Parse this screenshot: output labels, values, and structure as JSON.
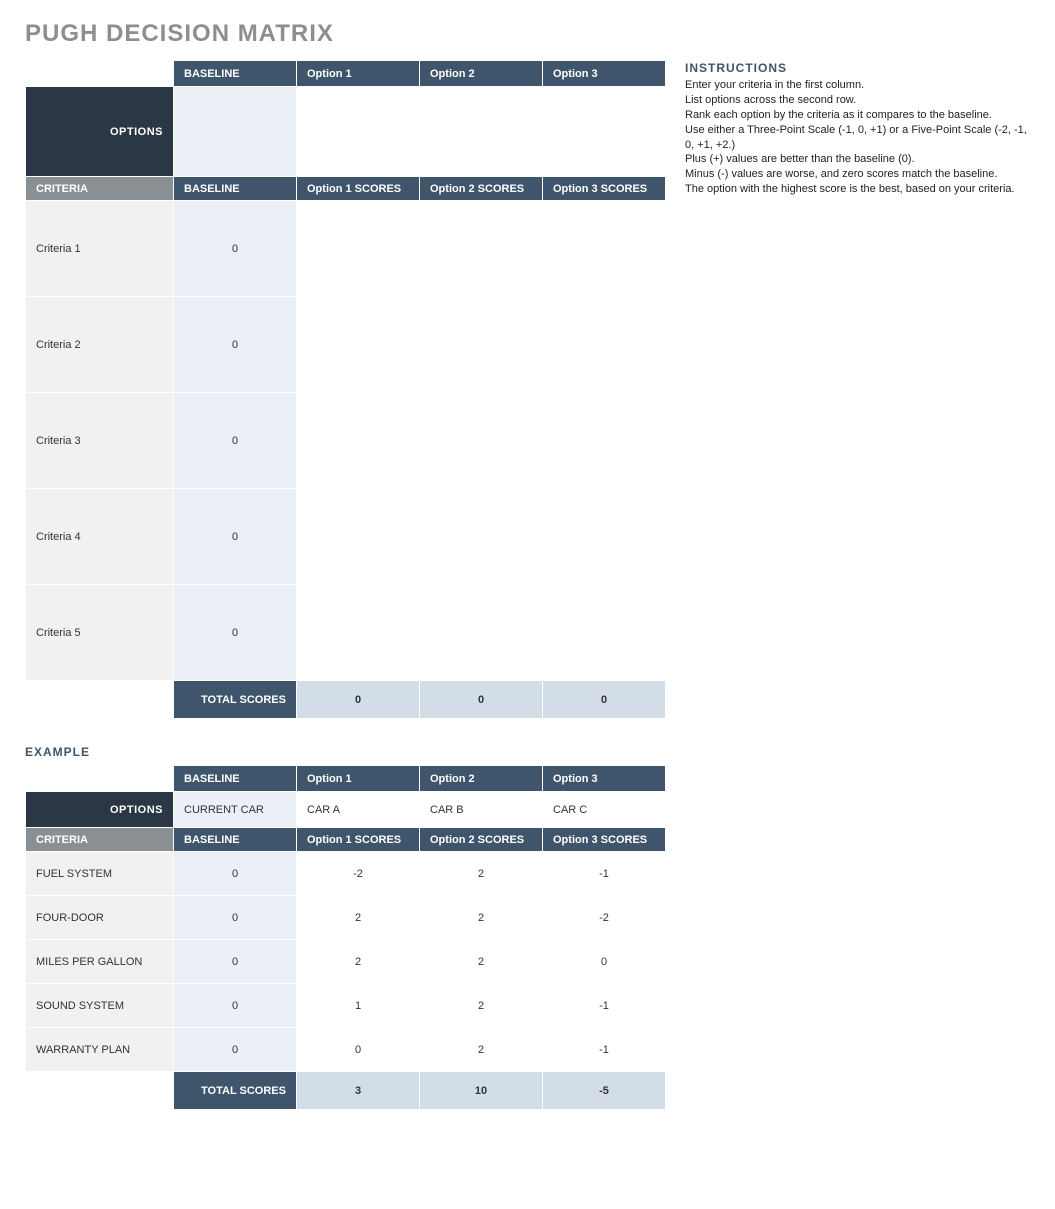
{
  "title": "PUGH DECISION MATRIX",
  "instructions": {
    "header": "INSTRUCTIONS",
    "lines": [
      "Enter your criteria in the first column.",
      "List options across the second row.",
      "Rank each option by the criteria as it compares to the baseline.",
      "Use either a Three-Point Scale (-1, 0, +1) or a Five-Point Scale (-2, -1, 0, +1, +2.)",
      "Plus (+) values are better than the baseline (0).",
      "Minus (-) values are worse, and zero scores match the baseline.",
      "The option with the highest score is the best, based on your criteria."
    ]
  },
  "labels": {
    "options": "OPTIONS",
    "criteria": "CRITERIA",
    "baseline": "BASELINE",
    "total_scores": "TOTAL SCORES",
    "example": "EXAMPLE"
  },
  "main": {
    "option_headers": [
      "BASELINE",
      "Option 1",
      "Option 2",
      "Option 3"
    ],
    "option_values": [
      "",
      "",
      "",
      ""
    ],
    "score_headers": [
      "BASELINE",
      "Option 1 SCORES",
      "Option 2 SCORES",
      "Option 3 SCORES"
    ],
    "rows": [
      {
        "criteria": "Criteria 1",
        "baseline": "0",
        "scores": [
          "",
          "",
          ""
        ]
      },
      {
        "criteria": "Criteria 2",
        "baseline": "0",
        "scores": [
          "",
          "",
          ""
        ]
      },
      {
        "criteria": "Criteria 3",
        "baseline": "0",
        "scores": [
          "",
          "",
          ""
        ]
      },
      {
        "criteria": "Criteria 4",
        "baseline": "0",
        "scores": [
          "",
          "",
          ""
        ]
      },
      {
        "criteria": "Criteria 5",
        "baseline": "0",
        "scores": [
          "",
          "",
          ""
        ]
      }
    ],
    "totals": [
      "0",
      "0",
      "0"
    ]
  },
  "example": {
    "option_headers": [
      "BASELINE",
      "Option 1",
      "Option 2",
      "Option 3"
    ],
    "option_values": [
      "CURRENT CAR",
      "CAR A",
      "CAR B",
      "CAR C"
    ],
    "score_headers": [
      "BASELINE",
      "Option 1 SCORES",
      "Option 2 SCORES",
      "Option 3 SCORES"
    ],
    "rows": [
      {
        "criteria": "FUEL SYSTEM",
        "baseline": "0",
        "scores": [
          "-2",
          "2",
          "-1"
        ]
      },
      {
        "criteria": "FOUR-DOOR",
        "baseline": "0",
        "scores": [
          "2",
          "2",
          "-2"
        ]
      },
      {
        "criteria": "MILES PER GALLON",
        "baseline": "0",
        "scores": [
          "2",
          "2",
          "0"
        ]
      },
      {
        "criteria": "SOUND SYSTEM",
        "baseline": "0",
        "scores": [
          "1",
          "2",
          "-1"
        ]
      },
      {
        "criteria": "WARRANTY PLAN",
        "baseline": "0",
        "scores": [
          "0",
          "2",
          "-1"
        ]
      }
    ],
    "totals": [
      "3",
      "10",
      "-5"
    ]
  }
}
